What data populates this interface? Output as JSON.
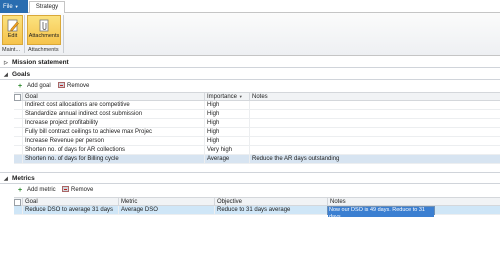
{
  "ribbon": {
    "file_tab": "File",
    "active_tab": "Strategy",
    "edit_label": "Edit",
    "attachments_label": "Attachments",
    "group_maintain": "Maint...",
    "group_attachments": "Attachments"
  },
  "mission": {
    "title": "Mission statement"
  },
  "goals": {
    "title": "Goals",
    "add_label": "Add goal",
    "remove_label": "Remove",
    "columns": [
      "Goal",
      "Importance",
      "Notes"
    ],
    "rows": [
      {
        "goal": "Indirect cost allocations are competitive",
        "importance": "High",
        "notes": ""
      },
      {
        "goal": "Standardize annual indirect cost submission",
        "importance": "High",
        "notes": ""
      },
      {
        "goal": "Increase project profitability",
        "importance": "High",
        "notes": ""
      },
      {
        "goal": "Fully bill contract ceilings to achieve max Projec",
        "importance": "High",
        "notes": ""
      },
      {
        "goal": "Increase Revenue per person",
        "importance": "High",
        "notes": ""
      },
      {
        "goal": "Shorten no. of days for AR collections",
        "importance": "Very high",
        "notes": ""
      },
      {
        "goal": "Shorten no. of days for Billing cycle",
        "importance": "Average",
        "notes": "Reduce the AR days outstanding"
      }
    ]
  },
  "metrics": {
    "title": "Metrics",
    "add_label": "Add metric",
    "remove_label": "Remove",
    "columns": [
      "Goal",
      "Metric",
      "Objective",
      "Notes"
    ],
    "rows": [
      {
        "goal": "Reduce DSO  to average 31 days",
        "metric": "Average DSO",
        "objective": "Reduce to 31 days average",
        "notes": "Now our DSO is 49 days. Reduce to 31 days"
      }
    ]
  }
}
